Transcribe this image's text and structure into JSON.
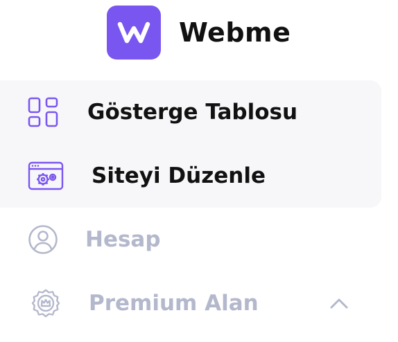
{
  "brand": {
    "name": "Webme",
    "logo_icon": "webme-w-logo",
    "logo_color": "#7a56f0"
  },
  "menu": {
    "items": [
      {
        "label": "Gösterge Tablosu",
        "icon": "dashboard-grid-icon",
        "state": "active"
      },
      {
        "label": "Siteyi Düzenle",
        "icon": "browser-settings-icon",
        "state": "active"
      },
      {
        "label": "Hesap",
        "icon": "user-icon",
        "state": "inactive"
      },
      {
        "label": "Premium Alan",
        "icon": "premium-badge-icon",
        "state": "inactive",
        "expandable": true,
        "expanded": true
      }
    ]
  },
  "colors": {
    "accent": "#7a56f0",
    "active_text": "#111111",
    "inactive_text": "#b4b8cc",
    "active_bg": "#f7f7fa"
  }
}
